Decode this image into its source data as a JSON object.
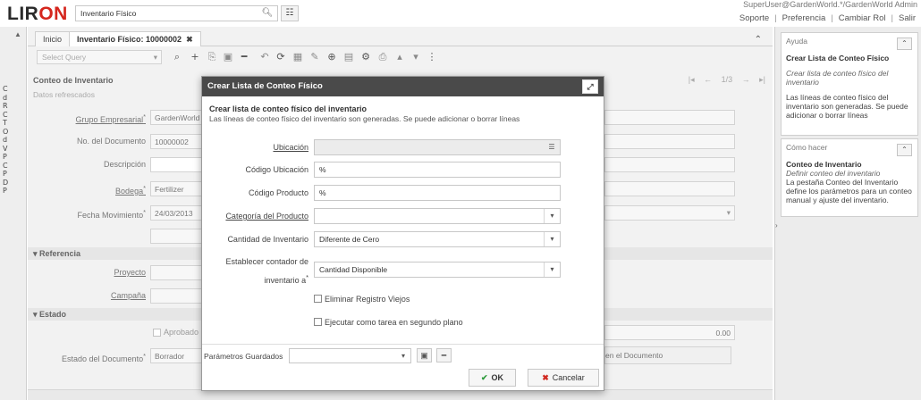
{
  "header": {
    "logo_main": "LIR",
    "logo_accent": "ON",
    "search_value": "Inventario Físico",
    "user": "SuperUser@GardenWorld.*/GardenWorld Admin",
    "links": [
      "Soporte",
      "Preferencia",
      "Cambiar Rol",
      "Salir"
    ]
  },
  "tabs": [
    {
      "label": "Inicio"
    },
    {
      "label": "Inventario Físico: 10000002"
    }
  ],
  "toolbar": {
    "select_query_placeholder": "Select Query"
  },
  "window": {
    "section_title": "Conteo de Inventario",
    "refreshed": "Datos refrescados",
    "nav_pages": "1/3",
    "fields": {
      "grupo_empresarial": {
        "label": "Grupo Empresarial",
        "value": "GardenWorld"
      },
      "no_documento": {
        "label": "No. del Documento",
        "value": "10000002"
      },
      "descripcion": {
        "label": "Descripción",
        "value": ""
      },
      "bodega": {
        "label": "Bodega",
        "value": "Fertilizer"
      },
      "fecha_movimiento": {
        "label": "Fecha Movimiento",
        "value": "24/03/2013"
      },
      "proyecto": {
        "label": "Proyecto"
      },
      "campana": {
        "label": "Campaña"
      },
      "aprobado": {
        "label": "Aprobado"
      },
      "estado_documento": {
        "label": "Estado del Documento",
        "value": "Borrador"
      },
      "en_documento": {
        "value": "en el Documento"
      },
      "total": {
        "value": "0.00"
      }
    },
    "sections": {
      "referencia": "Referencia",
      "estado": "Estado"
    },
    "left_strip_glyphs": "C d R C T O d V P C P D P"
  },
  "help": {
    "ayuda_title": "Ayuda",
    "ayuda_heading": "Crear Lista de Conteo Físico",
    "ayuda_italic": "Crear lista de conteo físico del inventario",
    "ayuda_body": "Las líneas de conteo físico del inventario son generadas. Se puede adicionar o borrar líneas",
    "como_title": "Cómo hacer",
    "como_heading": "Conteo de Inventario",
    "como_italic": "Definir conteo del inventario",
    "como_body": "La pestaña Conteo del Inventario define los parámetros para un conteo manual y ajuste del inventario."
  },
  "dialog": {
    "title": "Crear Lista de Conteo Físico",
    "heading": "Crear lista de conteo físico del inventario",
    "description": "Las líneas de conteo físico del inventario son generadas. Se puede adicionar o borrar líneas",
    "fields": {
      "ubicacion": {
        "label": "Ubicación",
        "value": ""
      },
      "codigo_ubicacion": {
        "label": "Código Ubicación",
        "value": "%"
      },
      "codigo_producto": {
        "label": "Código Producto",
        "value": "%"
      },
      "categoria": {
        "label": "Categoría del Producto",
        "value": ""
      },
      "cantidad_inventario": {
        "label": "Cantidad de Inventario",
        "value": "Diferente de Cero"
      },
      "contador_line1": "Establecer contador de",
      "contador_line2": "inventario a",
      "contador_value": "Cantidad Disponible"
    },
    "checks": {
      "eliminar": "Eliminar Registro Viejos",
      "ejecutar": "Ejecutar como tarea en segundo plano"
    },
    "saved_params_label": "Parámetros Guardados",
    "ok_label": "OK",
    "cancel_label": "Cancelar"
  }
}
